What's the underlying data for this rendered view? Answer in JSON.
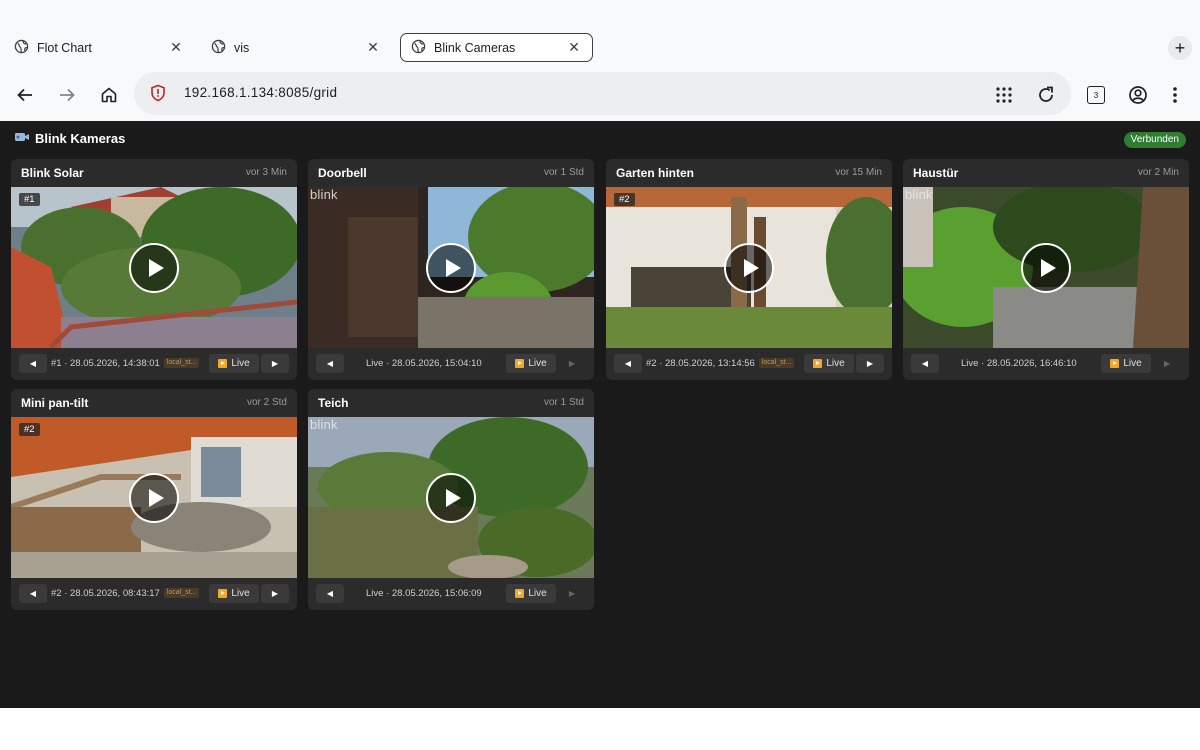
{
  "browser": {
    "tabs": [
      {
        "title": "Flot Chart",
        "active": false
      },
      {
        "title": "vis",
        "active": false
      },
      {
        "title": "Blink Cameras",
        "active": true
      }
    ],
    "address": "192.168.1.134:8085/grid",
    "tab_count": "3"
  },
  "app": {
    "title": "Blink Kameras",
    "status": "Verbunden",
    "live_label": "Live"
  },
  "cameras": [
    {
      "name": "Blink Solar",
      "ago": "vor 3 Min",
      "badge": "#1",
      "info": "#1 · 28.05.2026, 14:38:01",
      "source": "local_st...",
      "next_enabled": true,
      "blink_logo": ""
    },
    {
      "name": "Doorbell",
      "ago": "vor 1 Std",
      "badge": "",
      "info": "Live · 28.05.2026, 15:04:10",
      "source": "",
      "next_enabled": false,
      "blink_logo": "blink"
    },
    {
      "name": "Garten hinten",
      "ago": "vor 15 Min",
      "badge": "#2",
      "info": "#2 · 28.05.2026, 13:14:56",
      "source": "local_st...",
      "next_enabled": true,
      "blink_logo": ""
    },
    {
      "name": "Haustür",
      "ago": "vor 2 Min",
      "badge": "",
      "info": "Live · 28.05.2026, 16:46:10",
      "source": "",
      "next_enabled": false,
      "blink_logo": "blink"
    },
    {
      "name": "Mini pan-tilt",
      "ago": "vor 2 Std",
      "badge": "#2",
      "info": "#2 · 28.05.2026, 08:43:17",
      "source": "local_st...",
      "next_enabled": true,
      "blink_logo": ""
    },
    {
      "name": "Teich",
      "ago": "vor 1 Std",
      "badge": "",
      "info": "Live · 28.05.2026, 15:06:09",
      "source": "",
      "next_enabled": false,
      "blink_logo": "blink"
    }
  ],
  "icons": {
    "tab_favicon": "globe-icon",
    "close": "close-icon",
    "new_tab": "plus-icon",
    "back": "arrow-left-icon",
    "forward": "arrow-right-icon",
    "home": "home-icon",
    "security": "shield-icon",
    "apps": "apps-grid-icon",
    "reload": "reload-icon",
    "tabs": "tab-counter-icon",
    "profile": "account-icon",
    "menu": "kebab-menu-icon",
    "camera": "video-camera-icon",
    "play": "play-icon"
  },
  "colors": {
    "app_bg": "#1a1a1a",
    "card_bg": "#2b2b2b",
    "status_green": "#2e7d32",
    "live_orange": "#f5a623"
  }
}
